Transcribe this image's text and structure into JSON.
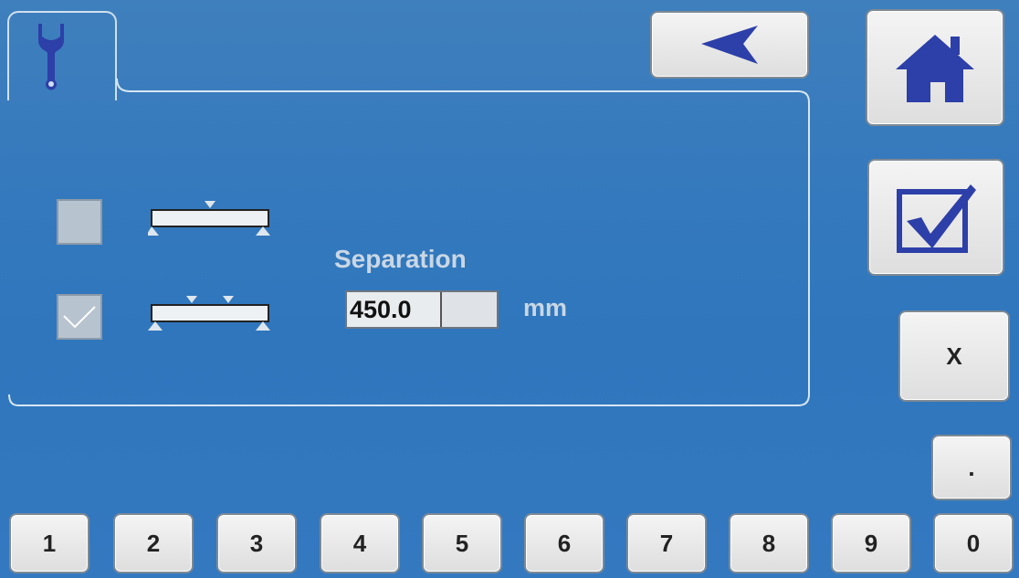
{
  "header": {
    "tab_icon": "wrench-icon",
    "back_icon": "back-arrow-icon",
    "home_icon": "home-icon",
    "confirm_icon": "checkbox-check-icon"
  },
  "options": [
    {
      "checked": false,
      "icon": "beam-single-load-icon"
    },
    {
      "checked": true,
      "icon": "beam-two-load-icon"
    }
  ],
  "separation": {
    "label": "Separation",
    "value": "450.0",
    "unit": "mm"
  },
  "keypad": {
    "clear_label": "X",
    "dot_label": ".",
    "digits": [
      "1",
      "2",
      "3",
      "4",
      "5",
      "6",
      "7",
      "8",
      "9",
      "0"
    ]
  },
  "colors": {
    "icon_blue": "#2d3fa8",
    "background": "#3479bd"
  }
}
